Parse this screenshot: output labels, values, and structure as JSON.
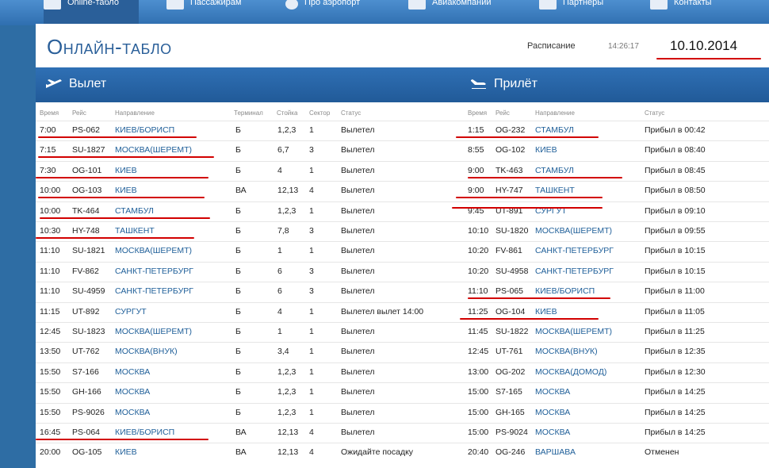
{
  "nav": [
    {
      "label": "Online-табло",
      "icon": "board-icon",
      "active": true
    },
    {
      "label": "Пассажирам",
      "icon": "passengers-icon",
      "active": false
    },
    {
      "label": "Про аэропорт",
      "icon": "airport-icon",
      "active": false
    },
    {
      "label": "Авиакомпании",
      "icon": "airlines-icon",
      "active": false
    },
    {
      "label": "Партнеры",
      "icon": "partners-icon",
      "active": false
    },
    {
      "label": "Контакты",
      "icon": "contacts-icon",
      "active": false
    }
  ],
  "header": {
    "title": "Онлайн-табло",
    "schedule_link": "Расписание",
    "time": "14:26:17",
    "date": "10.10.2014"
  },
  "departures": {
    "title": "Вылет",
    "columns": [
      "Время",
      "Рейс",
      "Направление",
      "Терминал",
      "Стойка",
      "Сектор",
      "Статус"
    ],
    "rows": [
      {
        "time": "7:00",
        "flight": "PS-062",
        "dest": "КИЕВ/БОРИСП",
        "terminal": "Б",
        "desk": "1,2,3",
        "sector": "1",
        "status": "Вылетел"
      },
      {
        "time": "7:15",
        "flight": "SU-1827",
        "dest": "МОСКВА(ШЕРЕМТ)",
        "terminal": "Б",
        "desk": "6,7",
        "sector": "3",
        "status": "Вылетел"
      },
      {
        "time": "7:30",
        "flight": "OG-101",
        "dest": "КИЕВ",
        "terminal": "Б",
        "desk": "4",
        "sector": "1",
        "status": "Вылетел"
      },
      {
        "time": "10:00",
        "flight": "OG-103",
        "dest": "КИЕВ",
        "terminal": "ВА",
        "desk": "12,13",
        "sector": "4",
        "status": "Вылетел"
      },
      {
        "time": "10:00",
        "flight": "TK-464",
        "dest": "СТАМБУЛ",
        "terminal": "Б",
        "desk": "1,2,3",
        "sector": "1",
        "status": "Вылетел"
      },
      {
        "time": "10:30",
        "flight": "HY-748",
        "dest": "ТАШКЕНТ",
        "terminal": "Б",
        "desk": "7,8",
        "sector": "3",
        "status": "Вылетел"
      },
      {
        "time": "11:10",
        "flight": "SU-1821",
        "dest": "МОСКВА(ШЕРЕМТ)",
        "terminal": "Б",
        "desk": "1",
        "sector": "1",
        "status": "Вылетел"
      },
      {
        "time": "11:10",
        "flight": "FV-862",
        "dest": "САНКТ-ПЕТЕРБУРГ",
        "terminal": "Б",
        "desk": "6",
        "sector": "3",
        "status": "Вылетел"
      },
      {
        "time": "11:10",
        "flight": "SU-4959",
        "dest": "САНКТ-ПЕТЕРБУРГ",
        "terminal": "Б",
        "desk": "6",
        "sector": "3",
        "status": "Вылетел"
      },
      {
        "time": "11:15",
        "flight": "UT-892",
        "dest": "СУРГУТ",
        "terminal": "Б",
        "desk": "4",
        "sector": "1",
        "status": "Вылетел вылет 14:00"
      },
      {
        "time": "12:45",
        "flight": "SU-1823",
        "dest": "МОСКВА(ШЕРЕМТ)",
        "terminal": "Б",
        "desk": "1",
        "sector": "1",
        "status": "Вылетел"
      },
      {
        "time": "13:50",
        "flight": "UT-762",
        "dest": "МОСКВА(ВНУК)",
        "terminal": "Б",
        "desk": "3,4",
        "sector": "1",
        "status": "Вылетел"
      },
      {
        "time": "15:50",
        "flight": "S7-166",
        "dest": "МОСКВА",
        "terminal": "Б",
        "desk": "1,2,3",
        "sector": "1",
        "status": "Вылетел"
      },
      {
        "time": "15:50",
        "flight": "GH-166",
        "dest": "МОСКВА",
        "terminal": "Б",
        "desk": "1,2,3",
        "sector": "1",
        "status": "Вылетел"
      },
      {
        "time": "15:50",
        "flight": "PS-9026",
        "dest": "МОСКВА",
        "terminal": "Б",
        "desk": "1,2,3",
        "sector": "1",
        "status": "Вылетел"
      },
      {
        "time": "16:45",
        "flight": "PS-064",
        "dest": "КИЕВ/БОРИСП",
        "terminal": "ВА",
        "desk": "12,13",
        "sector": "4",
        "status": "Вылетел"
      },
      {
        "time": "20:00",
        "flight": "OG-105",
        "dest": "КИЕВ",
        "terminal": "ВА",
        "desk": "12,13",
        "sector": "4",
        "status": "Ожидайте посадку"
      }
    ]
  },
  "arrivals": {
    "title": "Прилёт",
    "columns": [
      "Время",
      "Рейс",
      "Направление",
      "Статус"
    ],
    "rows": [
      {
        "time": "1:15",
        "flight": "OG-232",
        "dest": "СТАМБУЛ",
        "status": "Прибыл в 00:42"
      },
      {
        "time": "8:55",
        "flight": "OG-102",
        "dest": "КИЕВ",
        "status": "Прибыл в 08:40"
      },
      {
        "time": "9:00",
        "flight": "TK-463",
        "dest": "СТАМБУЛ",
        "status": "Прибыл в 08:45"
      },
      {
        "time": "9:00",
        "flight": "HY-747",
        "dest": "ТАШКЕНТ",
        "status": "Прибыл в 08:50"
      },
      {
        "time": "9:45",
        "flight": "UT-891",
        "dest": "СУРГУТ",
        "status": "Прибыл в 09:10"
      },
      {
        "time": "10:10",
        "flight": "SU-1820",
        "dest": "МОСКВА(ШЕРЕМТ)",
        "status": "Прибыл в 09:55"
      },
      {
        "time": "10:20",
        "flight": "FV-861",
        "dest": "САНКТ-ПЕТЕРБУРГ",
        "status": "Прибыл в 10:15"
      },
      {
        "time": "10:20",
        "flight": "SU-4958",
        "dest": "САНКТ-ПЕТЕРБУРГ",
        "status": "Прибыл в 10:15"
      },
      {
        "time": "11:10",
        "flight": "PS-065",
        "dest": "КИЕВ/БОРИСП",
        "status": "Прибыл в 11:00"
      },
      {
        "time": "11:25",
        "flight": "OG-104",
        "dest": "КИЕВ",
        "status": "Прибыл в 11:05"
      },
      {
        "time": "11:45",
        "flight": "SU-1822",
        "dest": "МОСКВА(ШЕРЕМТ)",
        "status": "Прибыл в 11:25"
      },
      {
        "time": "12:45",
        "flight": "UT-761",
        "dest": "МОСКВА(ВНУК)",
        "status": "Прибыл в 12:35"
      },
      {
        "time": "13:00",
        "flight": "OG-202",
        "dest": "МОСКВА(ДОМОД)",
        "status": "Прибыл в 12:30"
      },
      {
        "time": "15:00",
        "flight": "S7-165",
        "dest": "МОСКВА",
        "status": "Прибыл в 14:25"
      },
      {
        "time": "15:00",
        "flight": "GH-165",
        "dest": "МОСКВА",
        "status": "Прибыл в 14:25"
      },
      {
        "time": "15:00",
        "flight": "PS-9024",
        "dest": "МОСКВА",
        "status": "Прибыл в 14:25"
      },
      {
        "time": "20:40",
        "flight": "OG-246",
        "dest": "ВАРШАВА",
        "status": "Отменен"
      }
    ]
  },
  "colors": {
    "accent": "#2a5f99",
    "nav": "#3a7cc0",
    "highlight_mark": "#d20000",
    "dest_text": "#1f5f99"
  }
}
